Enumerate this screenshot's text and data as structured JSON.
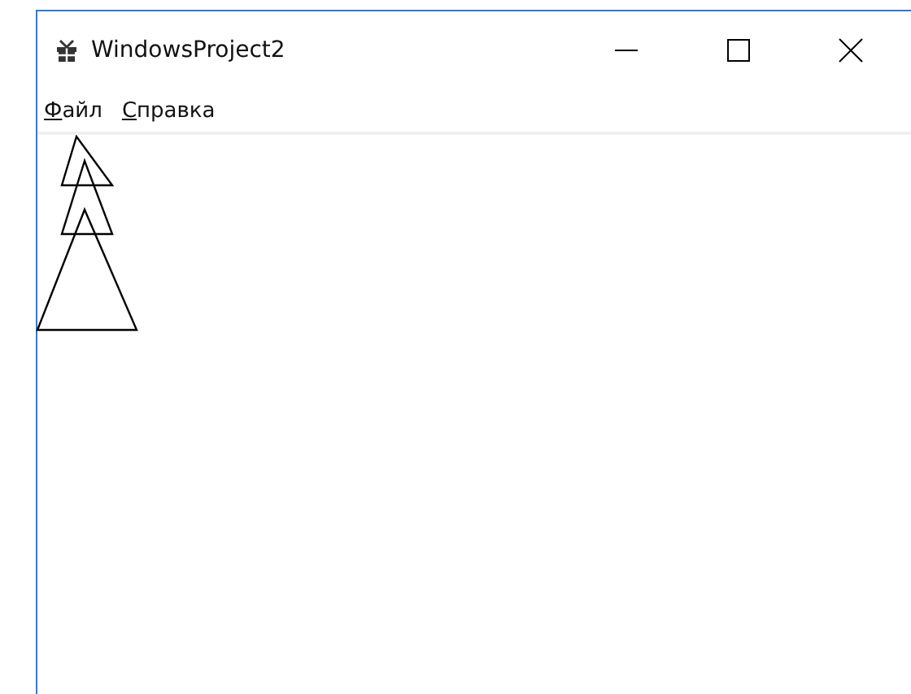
{
  "window": {
    "title": "WindowsProject2"
  },
  "menu": [
    {
      "label": "Файл"
    },
    {
      "label": "Справка"
    }
  ]
}
